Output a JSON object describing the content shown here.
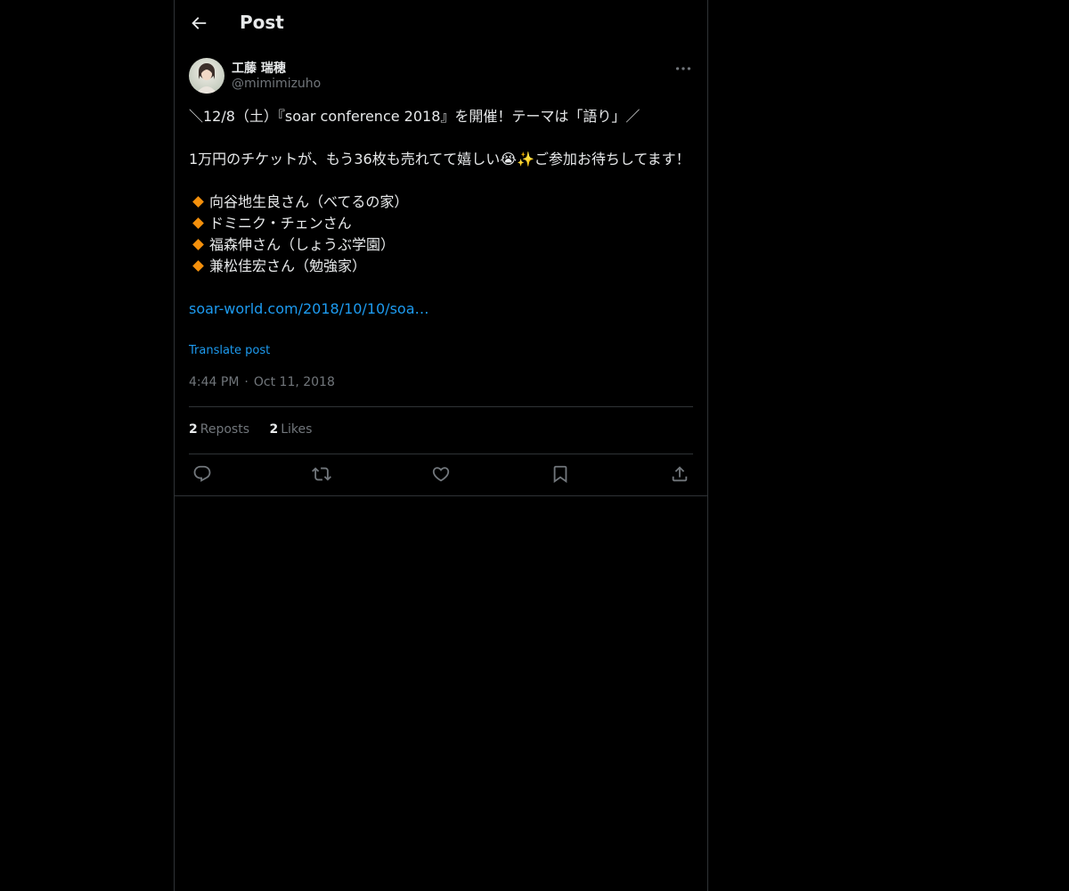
{
  "header": {
    "title": "Post",
    "back_icon": "arrow-left-icon"
  },
  "post": {
    "author_name": "工藤 瑞穂",
    "author_handle": "@mimimizuho",
    "more_icon": "more-horizontal-icon",
    "text_lines": [
      "＼12/8（土）『soar conference 2018』を開催！テーマは「語り」／",
      "1万円のチケットが、もう36枚も売れてて嬉しい😭✨ご参加お待ちしてます！"
    ],
    "speakers": [
      "向谷地生良さん（べてるの家）",
      "ドミニク・チェンさん",
      "福森伸さん（しょうぶ学園）",
      "兼松佳宏さん（勉強家）"
    ],
    "link_text": "soar-world.com/2018/10/10/soa…",
    "translate_label": "Translate post",
    "time": "4:44 PM",
    "date": "Oct 11, 2018",
    "separator": "·"
  },
  "stats": {
    "reposts_count": "2",
    "reposts_label": "Reposts",
    "likes_count": "2",
    "likes_label": "Likes"
  },
  "actions": [
    "reply-icon",
    "repost-icon",
    "like-icon",
    "bookmark-icon",
    "share-icon"
  ],
  "colors": {
    "background": "#000000",
    "text": "#e7e9ea",
    "muted": "#71767b",
    "link": "#1d9bf0",
    "border": "#2f3336",
    "bullet": "#f4900c"
  }
}
